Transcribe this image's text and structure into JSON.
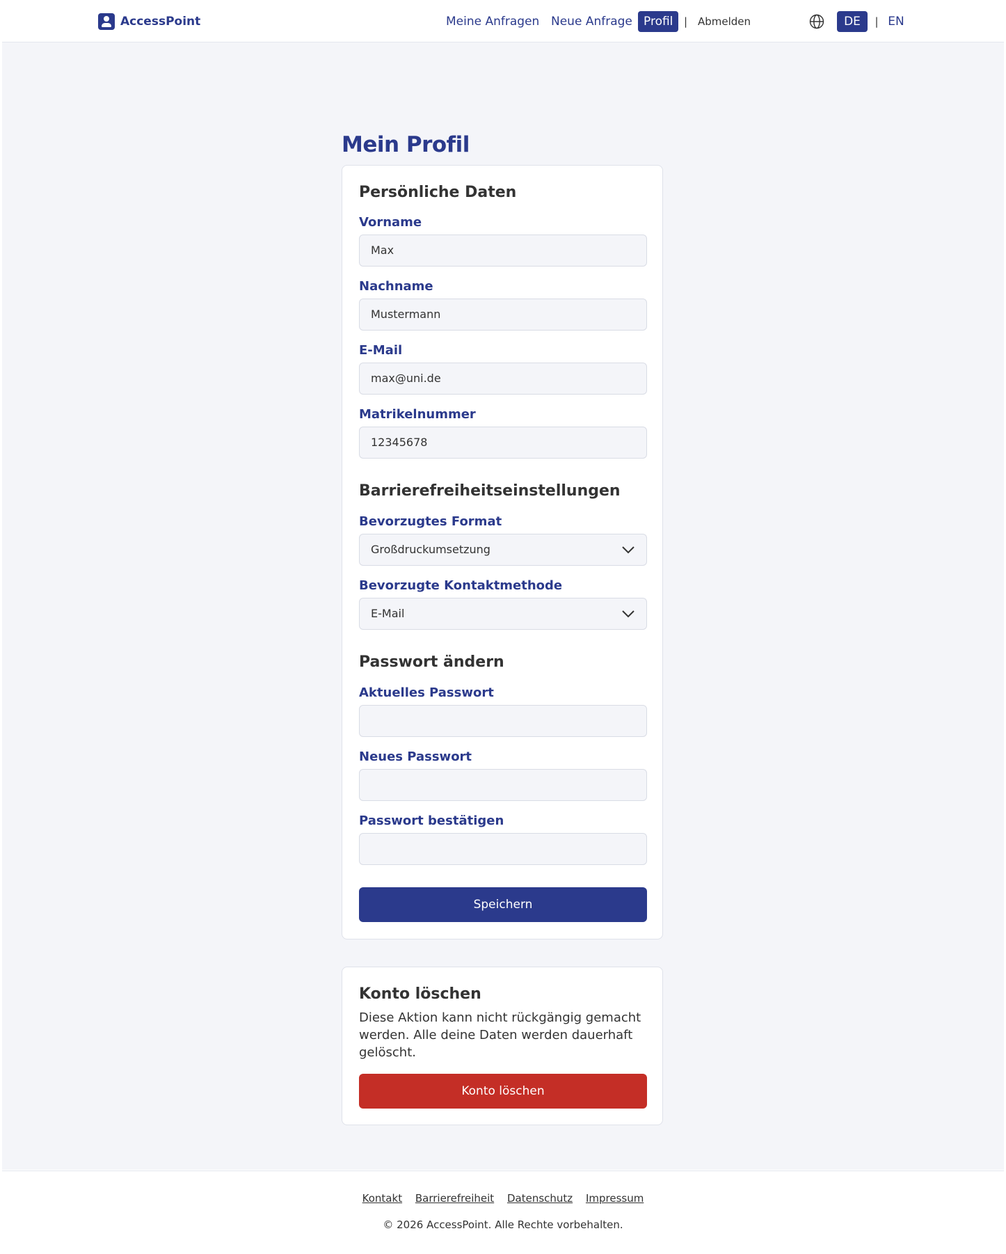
{
  "header": {
    "app_name": "AccessPoint",
    "nav": {
      "my_requests": "Meine Anfragen",
      "new_request": "Neue Anfrage",
      "profile": "Profil",
      "separator": "|",
      "logout": "Abmelden"
    },
    "language": {
      "de": "DE",
      "separator": "|",
      "en": "EN",
      "active": "DE"
    }
  },
  "page": {
    "title": "Mein Profil"
  },
  "profile_form": {
    "personal_section": {
      "title": "Persönliche Daten",
      "first_name": {
        "label": "Vorname",
        "value": "Max"
      },
      "last_name": {
        "label": "Nachname",
        "value": "Mustermann"
      },
      "email": {
        "label": "E-Mail",
        "value": "max@uni.de"
      },
      "student_id": {
        "label": "Matrikelnummer",
        "value": "12345678"
      }
    },
    "accessibility_section": {
      "title": "Barrierefreiheitseinstellungen",
      "preferred_format": {
        "label": "Bevorzugtes Format",
        "value": "Großdruckumsetzung"
      },
      "preferred_contact": {
        "label": "Bevorzugte Kontaktmethode",
        "value": "E-Mail"
      }
    },
    "password_section": {
      "title": "Passwort ändern",
      "current_password": {
        "label": "Aktuelles Passwort",
        "value": ""
      },
      "new_password": {
        "label": "Neues Passwort",
        "value": ""
      },
      "confirm_password": {
        "label": "Passwort bestätigen",
        "value": ""
      }
    },
    "save_label": "Speichern"
  },
  "delete_account": {
    "title": "Konto löschen",
    "warning": "Diese Aktion kann nicht rückgängig gemacht werden. Alle deine Daten werden dauerhaft gelöscht.",
    "button_label": "Konto löschen"
  },
  "footer": {
    "links": {
      "contact": "Kontakt",
      "accessibility": "Barrierefreiheit",
      "privacy": "Datenschutz",
      "imprint": "Impressum"
    },
    "copyright": "© 2026 AccessPoint. Alle Rechte vorbehalten."
  },
  "colors": {
    "primary": "#2b3a8c",
    "danger": "#c42e26",
    "background": "#f4f5f9",
    "text": "#333333"
  },
  "icons": {
    "logo": "user-badge-icon",
    "language": "globe-icon",
    "select": "chevron-down-icon"
  }
}
